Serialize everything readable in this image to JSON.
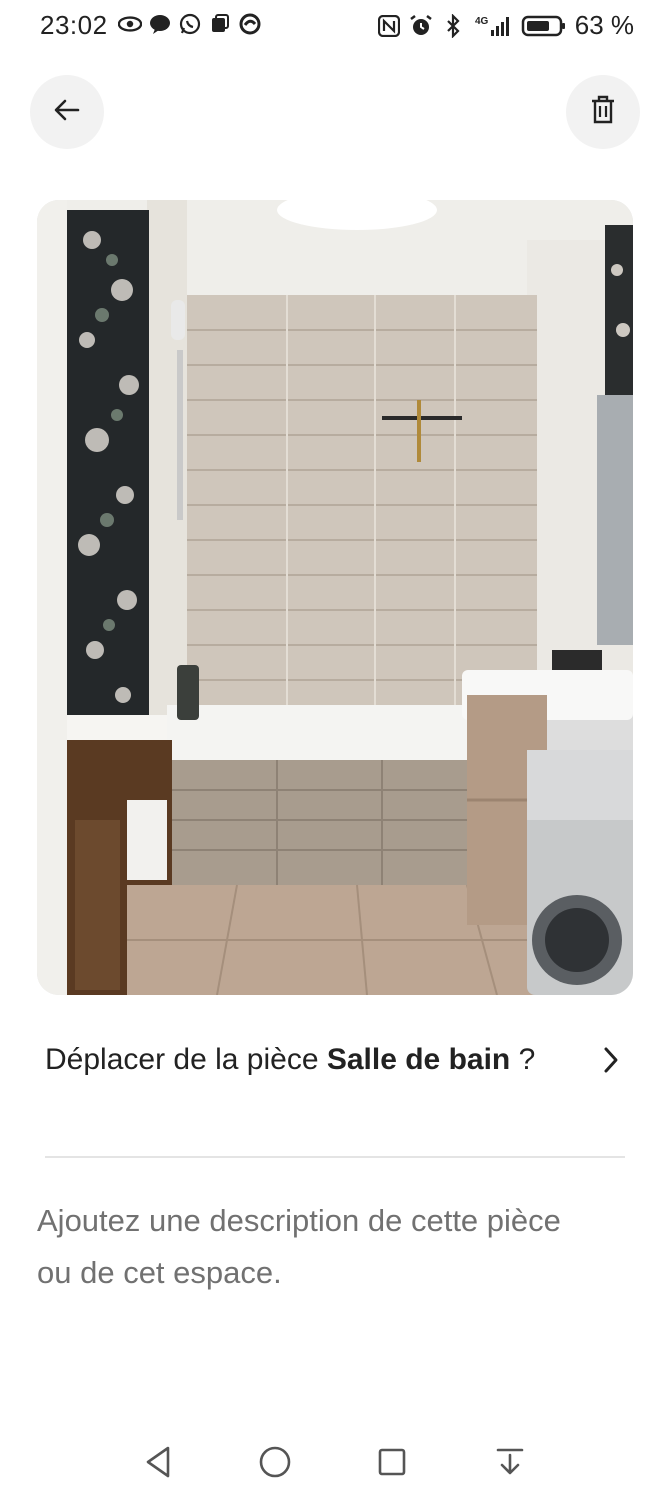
{
  "status_bar": {
    "time": "23:02",
    "network_label": "4G",
    "battery": "63 %"
  },
  "header": {
    "back_icon": "arrow-left-icon",
    "delete_icon": "trash-icon"
  },
  "photo": {
    "subject": "bathroom-photo"
  },
  "move_row": {
    "prefix": "Déplacer de la pièce ",
    "room_name": "Salle de bain",
    "suffix": " ?"
  },
  "description": {
    "placeholder": "Ajoutez une description de cette pièce ou de cet espace."
  },
  "colors": {
    "text_primary": "#222222",
    "text_secondary": "#717171",
    "divider": "#e4e4e4",
    "button_bg": "#f2f2f2"
  }
}
